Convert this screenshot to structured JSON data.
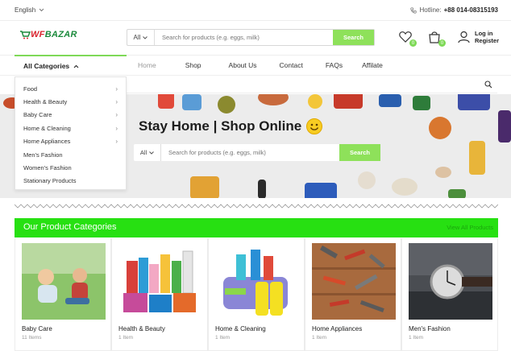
{
  "topbar": {
    "language": "English",
    "hotline_label": "Hotline:",
    "hotline_number": "+88 014-08315193"
  },
  "header": {
    "logo_text": "WFBAZAR",
    "logo_prefix": "WF",
    "logo_suffix": "BAZAR",
    "search_category": "All",
    "search_placeholder": "Search for products (e.g. eggs, milk)",
    "search_button": "Search",
    "wishlist_count": "0",
    "cart_count": "0",
    "login_line1": "Log in",
    "login_line2": "Register"
  },
  "nav": {
    "all_categories": "All Categories",
    "items": [
      "Home",
      "Shop",
      "About Us",
      "Contact",
      "FAQs",
      "Affilate"
    ],
    "active": "Home"
  },
  "dropdown": {
    "items": [
      {
        "label": "Food",
        "has_sub": true
      },
      {
        "label": "Health & Beauty",
        "has_sub": true
      },
      {
        "label": "Baby Care",
        "has_sub": true
      },
      {
        "label": "Home & Cleaning",
        "has_sub": true
      },
      {
        "label": "Home Appliances",
        "has_sub": true
      },
      {
        "label": "Men's Fashion",
        "has_sub": false
      },
      {
        "label": "Women's Fashion",
        "has_sub": false
      },
      {
        "label": "Stationary Products",
        "has_sub": false
      }
    ]
  },
  "hero": {
    "title": "Stay Home | Shop Online",
    "search_category": "All",
    "search_placeholder": "Search for products (e.g. eggs, milk)",
    "search_button": "Search"
  },
  "categories_section": {
    "title": "Our Product Categories",
    "view_all": "View All Products",
    "cards": [
      {
        "name": "Baby Care",
        "count": "11 Items"
      },
      {
        "name": "Health & Beauty",
        "count": "1 Item"
      },
      {
        "name": "Home & Cleaning",
        "count": "1 Item"
      },
      {
        "name": "Home Appliances",
        "count": "1 Item"
      },
      {
        "name": "Men's Fashion",
        "count": "1 Item"
      }
    ]
  },
  "colors": {
    "accent": "#7ed957",
    "section_green": "#27e012",
    "logo_green": "#1b8a3c",
    "logo_red": "#d9232d"
  }
}
